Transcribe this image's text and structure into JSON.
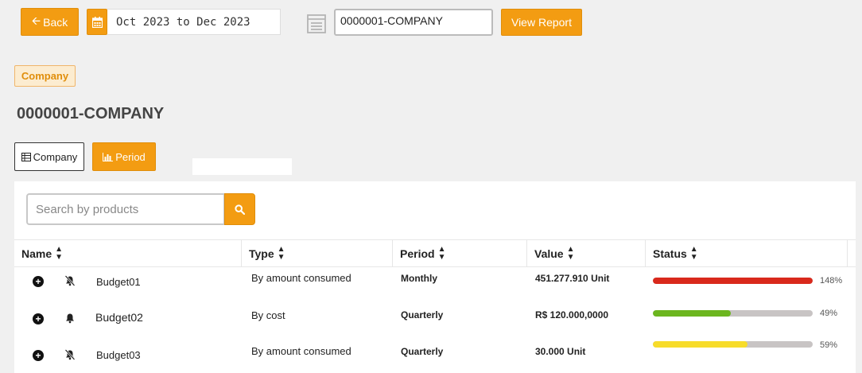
{
  "toolbar": {
    "back_label": "Back",
    "date_range": "Oct 2023 to Dec 2023",
    "company_value": "0000001-COMPANY",
    "view_report_label": "View Report"
  },
  "badge_label": "Company",
  "page_title": "0000001-COMPANY",
  "tabs": {
    "company_label": "Company",
    "period_label": "Period"
  },
  "search": {
    "placeholder": "Search by products"
  },
  "table": {
    "headers": {
      "name": "Name",
      "type": "Type",
      "period": "Period",
      "value": "Value",
      "status": "Status"
    },
    "rows": [
      {
        "name": "Budget01",
        "type": "By amount consumed",
        "period": "Monthly",
        "value": "451.277.910 Unit",
        "status_pct": "148%",
        "status_fraction": 1.0,
        "status_color": "#d9291c",
        "alert_icon": "bell-slash-icon"
      },
      {
        "name": "Budget02",
        "type": "By cost",
        "period": "Quarterly",
        "value": "R$ 120.000,0000",
        "status_pct": "49%",
        "status_fraction": 0.49,
        "status_color": "#6cb61f",
        "alert_icon": "bell-icon"
      },
      {
        "name": "Budget03",
        "type": "By amount consumed",
        "period": "Quarterly",
        "value": "30.000 Unit",
        "status_pct": "59%",
        "status_fraction": 0.59,
        "status_color": "#f7dc2a",
        "alert_icon": "bell-slash-icon"
      }
    ]
  },
  "colors": {
    "accent": "#f39c12",
    "background": "#f0f0f0"
  }
}
